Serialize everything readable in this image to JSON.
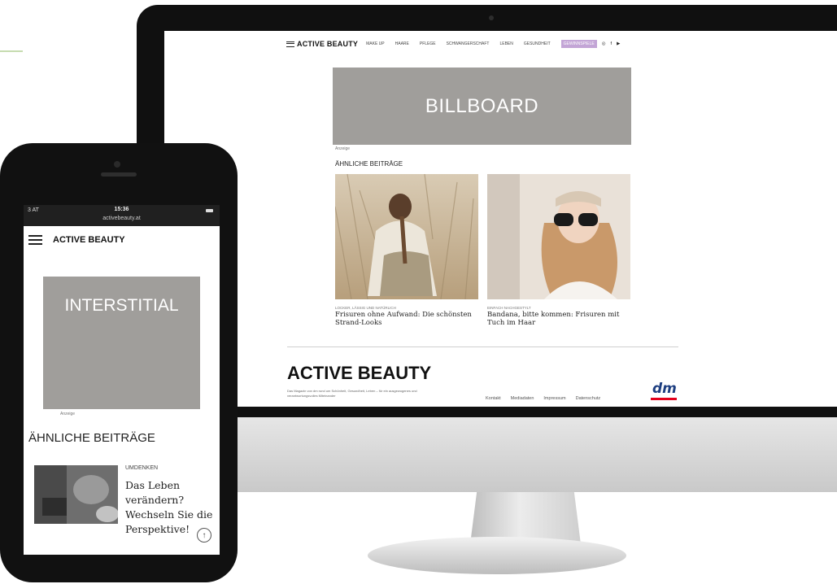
{
  "desktop": {
    "logo": "ACTIVE BEAUTY",
    "nav": [
      "MAKE UP",
      "HAARE",
      "PFLEGE",
      "SCHWANGERSCHAFT",
      "LEBEN",
      "GESUNDHEIT"
    ],
    "nav_badge": "GEWINNSPIELE",
    "social": [
      "◎",
      "f",
      "▶"
    ],
    "billboard": "BILLBOARD",
    "anzeige": "Anzeige",
    "similar_heading": "ÄHNLICHE BEITRÄGE",
    "cards": [
      {
        "category": "LOCKER, LÄSSIG UND NATÜRLICH",
        "title": "Frisuren ohne Aufwand: Die schönsten Strand-Looks"
      },
      {
        "category": "EINFACH NACHGESTYLT",
        "title": "Bandana, bitte kommen: Frisuren mit Tuch im Haar"
      }
    ],
    "footer": {
      "logo": "ACTIVE BEAUTY",
      "description": "Das Magazin von dm rund um Schönheit, Gesundheit, Leben – für ein ausgewogenes und verantwortungsvolles Miteinander",
      "links": [
        "Kontakt",
        "Mediadaten",
        "Impressum",
        "Datenschutz"
      ],
      "dm_logo": "dm"
    }
  },
  "phone": {
    "carrier": "3 AT",
    "time": "15:36",
    "url": "activebeauty.at",
    "logo": "ACTIVE BEAUTY",
    "interstitial": "INTERSTITIAL",
    "anzeige": "Anzeige",
    "similar_heading": "ÄHNLICHE BEITRÄGE",
    "article": {
      "category": "UMDENKEN",
      "title": "Das Leben verändern? Wechseln Sie die Perspektive!"
    },
    "scroll_top_icon": "↑"
  },
  "colors": {
    "placeholder_gray": "#a09e9b",
    "badge": "#c3a5d6",
    "dm_blue": "#1d3e80",
    "dm_red": "#e3001b"
  }
}
